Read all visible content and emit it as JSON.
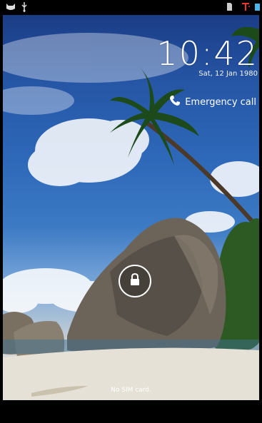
{
  "status_bar": {
    "left_icons": [
      "cat-icon",
      "usb-icon"
    ],
    "right_icons": [
      "sd-card-icon",
      "no-signal-icon",
      "battery-icon"
    ]
  },
  "lockscreen": {
    "time": "10:42",
    "date": "Sat, 12 Jan 1980",
    "emergency_label": "Emergency call",
    "sim_status": "No SIM card."
  },
  "colors": {
    "text": "#ffffff",
    "sky": "#2656a6",
    "status_bar": "#000000"
  }
}
